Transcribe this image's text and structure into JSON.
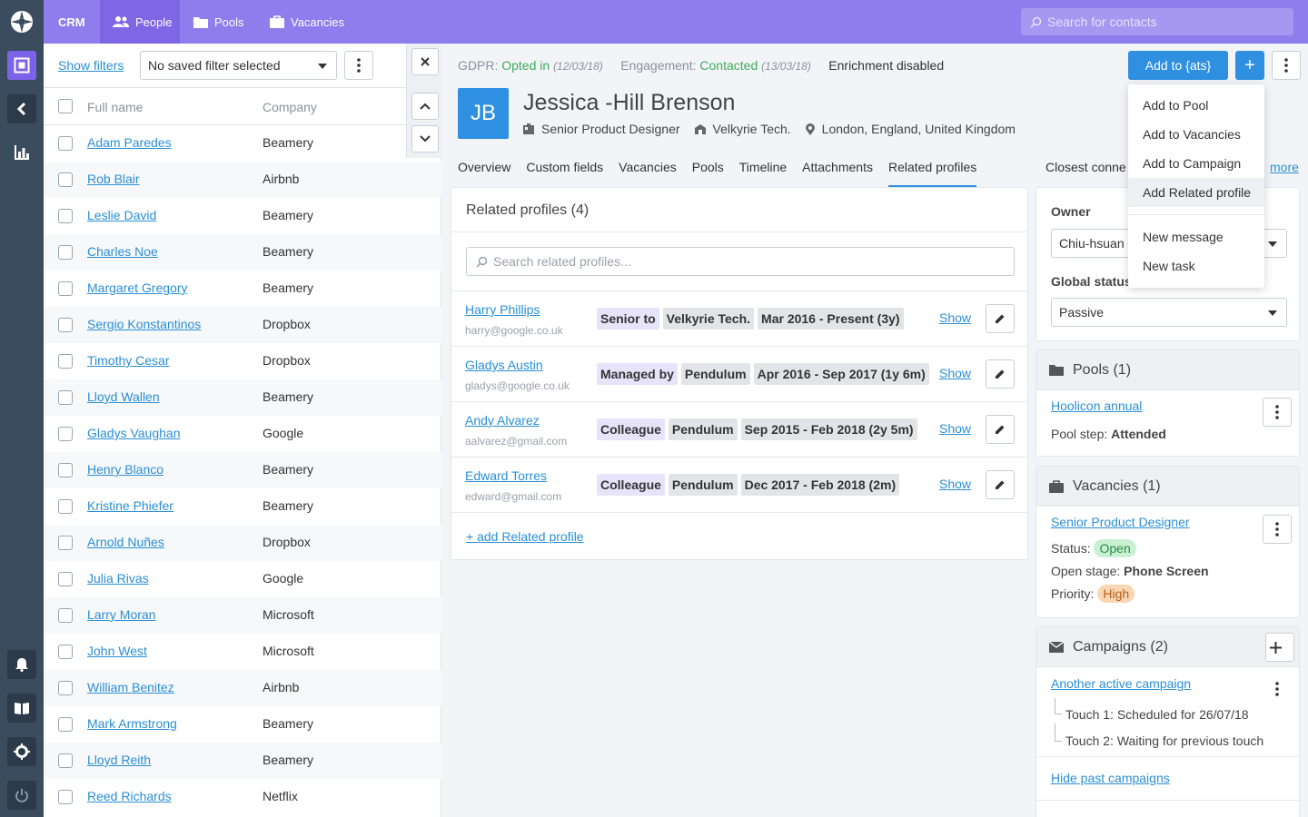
{
  "colors": {
    "accent": "#8f7ced",
    "primary_button": "#2f8fe0",
    "rail": "#3b4c5e",
    "link": "#2a8fd6"
  },
  "rail": {
    "icons": [
      "logo-icon",
      "page-icon",
      "collapse-icon",
      "analytics-icon",
      "bell-icon",
      "book-icon",
      "gear-icon",
      "power-icon"
    ]
  },
  "topbar": {
    "brand": "CRM",
    "tabs": [
      {
        "label": "People",
        "icon": "people-icon"
      },
      {
        "label": "Pools",
        "icon": "folder-icon"
      },
      {
        "label": "Vacancies",
        "icon": "briefcase-icon"
      }
    ],
    "search_placeholder": "Search for contacts"
  },
  "list": {
    "show_filters": "Show filters",
    "filter_value": "No saved filter selected",
    "col_name": "Full name",
    "col_company": "Company",
    "rows": [
      {
        "name": "Adam Paredes",
        "company": "Beamery"
      },
      {
        "name": "Rob Blair",
        "company": "Airbnb"
      },
      {
        "name": "Leslie David",
        "company": "Beamery"
      },
      {
        "name": "Charles Noe",
        "company": "Beamery"
      },
      {
        "name": "Margaret Gregory",
        "company": "Beamery"
      },
      {
        "name": "Sergio Konstantinos",
        "company": "Dropbox"
      },
      {
        "name": "Timothy Cesar",
        "company": "Dropbox"
      },
      {
        "name": "Lloyd Wallen",
        "company": "Beamery"
      },
      {
        "name": "Gladys Vaughan",
        "company": "Google"
      },
      {
        "name": "Henry Blanco",
        "company": "Beamery"
      },
      {
        "name": "Kristine Phiefer",
        "company": "Beamery"
      },
      {
        "name": "Arnold Nuñes",
        "company": "Dropbox"
      },
      {
        "name": "Julia Rivas",
        "company": "Google"
      },
      {
        "name": "Larry Moran",
        "company": "Microsoft"
      },
      {
        "name": "John West",
        "company": "Microsoft"
      },
      {
        "name": "William Benitez",
        "company": "Airbnb"
      },
      {
        "name": "Mark Armstrong",
        "company": "Beamery"
      },
      {
        "name": "Lloyd Reith",
        "company": "Beamery"
      },
      {
        "name": "Reed Richards",
        "company": "Netflix"
      }
    ]
  },
  "profile": {
    "gdpr_label": "GDPR:",
    "gdpr_value": "Opted in",
    "gdpr_date": "(12/03/18)",
    "engagement_label": "Engagement:",
    "engagement_value": "Contacted",
    "engagement_date": "(13/03/18)",
    "enrichment": "Enrichment disabled",
    "add_button": "Add to {ats}",
    "add_plus": "+",
    "initials": "JB",
    "name": "Jessica -Hill Brenson",
    "title": "Senior Product Designer",
    "company": "Velkyrie Tech.",
    "location": "London, England, United Kingdom",
    "tabs": [
      "Overview",
      "Custom fields",
      "Vacancies",
      "Pools",
      "Timeline",
      "Attachments",
      "Related profiles"
    ],
    "closest": "Closest conne",
    "more": "more"
  },
  "related": {
    "title": "Related profiles (4)",
    "search_placeholder": "Search related profiles...",
    "show_label": "Show",
    "add_link": "+ add Related profile",
    "rows": [
      {
        "name": "Harry Phillips",
        "email": "harry@google.co.uk",
        "relation": "Senior to",
        "company": "Velkyrie Tech.",
        "period": "Mar 2016 - Present (3y)"
      },
      {
        "name": "Gladys Austin",
        "email": "gladys@google.co.uk",
        "relation": "Managed by",
        "company": "Pendulum",
        "period": "Apr 2016 - Sep 2017 (1y 6m)"
      },
      {
        "name": "Andy Alvarez",
        "email": "aalvarez@gmail.com",
        "relation": "Colleague",
        "company": "Pendulum",
        "period": "Sep 2015 - Feb 2018 (2y 5m)"
      },
      {
        "name": "Edward Torres",
        "email": "edward@gmail.com",
        "relation": "Colleague",
        "company": "Pendulum",
        "period": "Dec 2017 - Feb 2018 (2m)"
      }
    ]
  },
  "owner": {
    "label": "Owner",
    "value": "Chiu-hsuan H",
    "status_label": "Global status",
    "status_value": "Passive"
  },
  "pools": {
    "title": "Pools (1)",
    "name": "Hoolicon annual",
    "step_label": "Pool step:",
    "step_value": "Attended"
  },
  "vacancies": {
    "title": "Vacancies (1)",
    "name": "Senior Product Designer",
    "status_label": "Status:",
    "status_value": "Open",
    "stage_label": "Open stage:",
    "stage_value": "Phone Screen",
    "priority_label": "Priority:",
    "priority_value": "High"
  },
  "campaigns": {
    "title": "Campaigns (2)",
    "name": "Another active campaign",
    "touch1": "Touch 1: Scheduled for 26/07/18",
    "touch2": "Touch 2: Waiting for previous touch",
    "hide_past": "Hide past campaigns"
  },
  "menu": {
    "items": [
      "Add to Pool",
      "Add to Vacancies",
      "Add to Campaign",
      "Add Related profile"
    ],
    "items2": [
      "New message",
      "New task"
    ]
  }
}
